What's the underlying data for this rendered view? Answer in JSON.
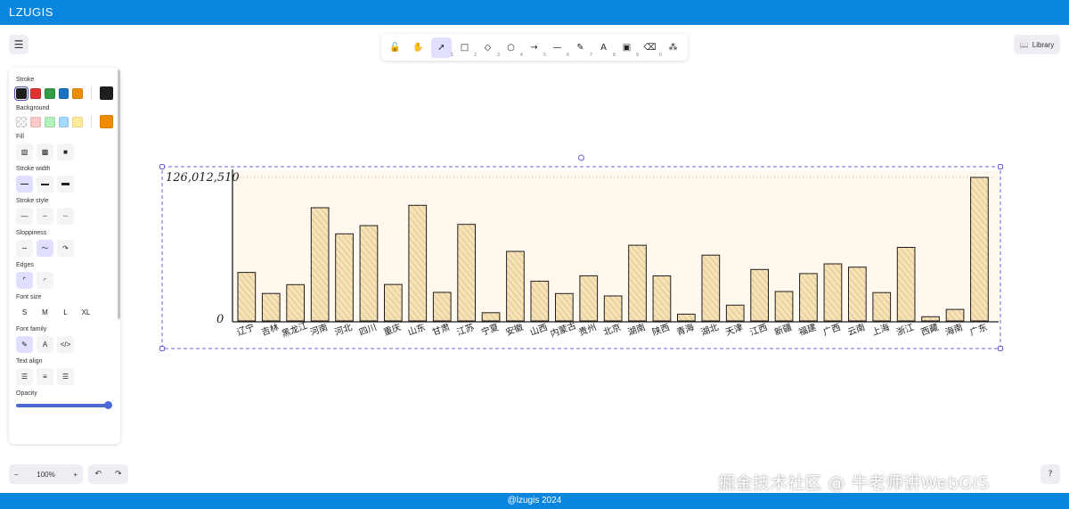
{
  "app": {
    "brand": "LZUGIS"
  },
  "footer": {
    "text": "@lzugis 2024"
  },
  "header": {
    "library_label": "Library"
  },
  "toolbar": {
    "tools": [
      {
        "name": "lock-tool",
        "icon": "lock-icon",
        "glyph": "🔓",
        "num": "",
        "active": false
      },
      {
        "name": "hand-tool",
        "icon": "hand-icon",
        "glyph": "✋",
        "num": "",
        "active": false
      },
      {
        "name": "selection-tool",
        "icon": "pointer-icon",
        "glyph": "➚",
        "num": "1",
        "active": true
      },
      {
        "name": "rectangle-tool",
        "icon": "square-icon",
        "glyph": "□",
        "num": "2",
        "active": false
      },
      {
        "name": "diamond-tool",
        "icon": "diamond-icon",
        "glyph": "◇",
        "num": "3",
        "active": false
      },
      {
        "name": "ellipse-tool",
        "icon": "circle-icon",
        "glyph": "○",
        "num": "4",
        "active": false
      },
      {
        "name": "arrow-tool",
        "icon": "arrow-icon",
        "glyph": "→",
        "num": "5",
        "active": false
      },
      {
        "name": "line-tool",
        "icon": "line-icon",
        "glyph": "—",
        "num": "6",
        "active": false
      },
      {
        "name": "draw-tool",
        "icon": "pencil-icon",
        "glyph": "✎",
        "num": "7",
        "active": false
      },
      {
        "name": "text-tool",
        "icon": "text-icon",
        "glyph": "A",
        "num": "8",
        "active": false
      },
      {
        "name": "image-tool",
        "icon": "image-icon",
        "glyph": "▣",
        "num": "9",
        "active": false
      },
      {
        "name": "eraser-tool",
        "icon": "eraser-icon",
        "glyph": "⌫",
        "num": "0",
        "active": false
      },
      {
        "name": "extra-tools",
        "icon": "shapes-icon",
        "glyph": "⁂",
        "num": "",
        "active": false
      }
    ]
  },
  "props": {
    "stroke_label": "Stroke",
    "stroke_colors": [
      "#1e1e1e",
      "#e03131",
      "#2f9e44",
      "#1971c2",
      "#f08c00"
    ],
    "stroke_current": "#1e1e1e",
    "background_label": "Background",
    "background_colors": [
      "transparent",
      "#ffc9c9",
      "#b2f2bb",
      "#a5d8ff",
      "#ffec99"
    ],
    "background_current": "#f08c00",
    "fill_label": "Fill",
    "stroke_width_label": "Stroke width",
    "stroke_style_label": "Stroke style",
    "sloppiness_label": "Sloppiness",
    "edges_label": "Edges",
    "font_size_label": "Font size",
    "font_sizes": [
      "S",
      "M",
      "L",
      "XL"
    ],
    "font_family_label": "Font family",
    "text_align_label": "Text align",
    "opacity_label": "Opacity",
    "opacity_value": 1.0
  },
  "zoom": {
    "minus": "−",
    "value": "100%",
    "plus": "+"
  },
  "watermark": "掘金技术社区 @ 牛老师讲WebGIS",
  "chart_data": {
    "type": "bar",
    "ymax_label": "126,012,510",
    "ymin_label": "0",
    "ylim": [
      0,
      126012510
    ],
    "categories": [
      "辽宁",
      "吉林",
      "黑龙江",
      "河南",
      "河北",
      "四川",
      "重庆",
      "山东",
      "甘肃",
      "江苏",
      "宁夏",
      "安徽",
      "山西",
      "内蒙古",
      "贵州",
      "北京",
      "湖南",
      "陕西",
      "青海",
      "湖北",
      "天津",
      "江西",
      "新疆",
      "福建",
      "广西",
      "云南",
      "上海",
      "浙江",
      "西藏",
      "海南",
      "广东"
    ],
    "values": [
      42590000,
      24070000,
      31850000,
      99370000,
      76490000,
      83680000,
      32050000,
      101530000,
      25020000,
      84750000,
      7200000,
      61030000,
      34920000,
      24050000,
      39630000,
      21890000,
      66480000,
      39530000,
      5920000,
      57750000,
      13870000,
      45190000,
      25850000,
      41540000,
      50130000,
      47210000,
      24870000,
      64570000,
      3650000,
      10080000,
      126012510
    ],
    "bar_fill": "#f5e2b8",
    "bar_stroke": "#1e1e1e",
    "plot_bg": "#fff8ee"
  }
}
